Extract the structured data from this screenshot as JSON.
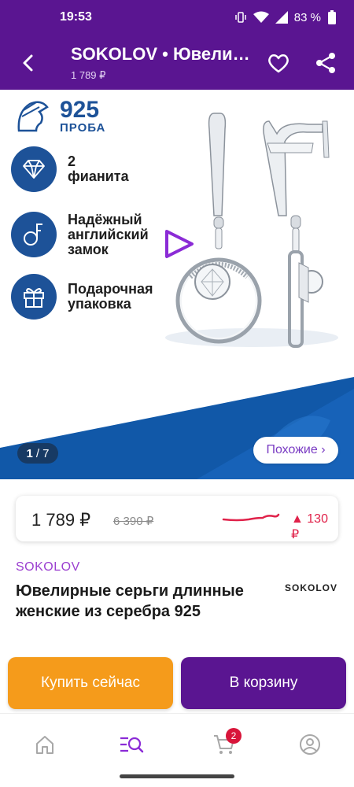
{
  "status_bar": {
    "time": "19:53",
    "battery": "83 %"
  },
  "app_bar": {
    "title": "SOKOLOV • Ювелирные серьги",
    "subtitle": "1 789 ₽"
  },
  "gallery": {
    "probe_number": "925",
    "probe_label": "ПРОБА",
    "features": [
      {
        "icon": "diamond-icon",
        "text": "2\nфианита"
      },
      {
        "icon": "lock-icon",
        "text": "Надёжный\nанглийский\nзамок"
      },
      {
        "icon": "gift-icon",
        "text": "Подарочная\nупаковка"
      }
    ],
    "counter_current": "1",
    "counter_total": "/ 7",
    "similar_label": "Похожие ›"
  },
  "price": {
    "current": "1 789 ₽",
    "old": "6 390 ₽",
    "change": "▲ 130 ₽"
  },
  "product": {
    "brand": "SOKOLOV",
    "title": "Ювелирные серьги длинные женские из серебра 925",
    "brand_logo": "SOKOLOV"
  },
  "actions": {
    "buy_now": "Купить сейчас",
    "add_to_cart": "В корзину"
  },
  "bottom_nav": {
    "cart_badge": "2"
  },
  "colors": {
    "brand_purple": "#5a1591",
    "accent_orange": "#f59b1b",
    "feature_blue": "#1d5298",
    "price_up_red": "#e0224a"
  }
}
